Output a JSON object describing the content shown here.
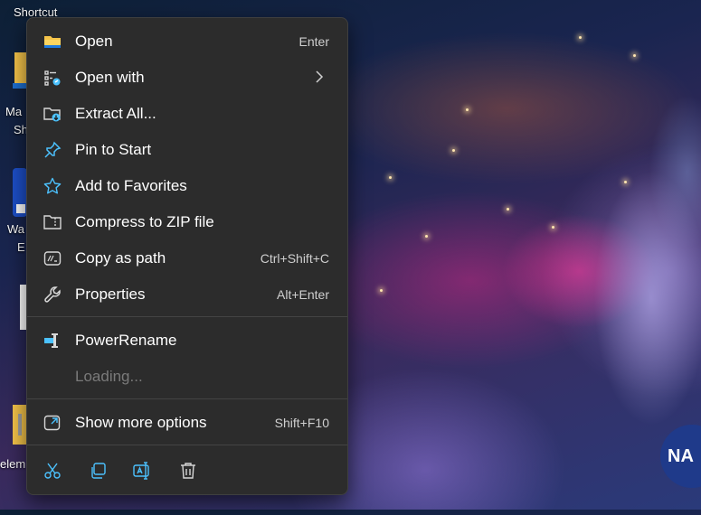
{
  "desktop": {
    "labels": {
      "top": "Shortcut",
      "icon2_a": "Ma",
      "icon2_b": "Sh",
      "icon3_a": "Wa",
      "icon3_b": "E",
      "icon4": "elem"
    },
    "wallpaper_badge": "NA"
  },
  "menu": {
    "items": [
      {
        "label": "Open",
        "accel": "Enter",
        "icon": "folder-icon"
      },
      {
        "label": "Open with",
        "accel": "",
        "icon": "open-with-icon"
      },
      {
        "label": "Extract All...",
        "accel": "",
        "icon": "extract-icon"
      },
      {
        "label": "Pin to Start",
        "accel": "",
        "icon": "pin-icon"
      },
      {
        "label": "Add to Favorites",
        "accel": "",
        "icon": "star-icon"
      },
      {
        "label": "Compress to ZIP file",
        "accel": "",
        "icon": "zip-icon"
      },
      {
        "label": "Copy as path",
        "accel": "Ctrl+Shift+C",
        "icon": "copy-path-icon"
      },
      {
        "label": "Properties",
        "accel": "Alt+Enter",
        "icon": "wrench-icon"
      },
      {
        "label": "PowerRename",
        "accel": "",
        "icon": "powerrename-icon"
      },
      {
        "label": "Loading...",
        "accel": "",
        "icon": ""
      },
      {
        "label": "Show more options",
        "accel": "Shift+F10",
        "icon": "show-more-icon"
      }
    ],
    "toolbar": [
      "cut-icon",
      "copy-icon",
      "rename-icon",
      "delete-icon"
    ],
    "colors": {
      "background": "#2c2c2c",
      "accent": "#4cc2ff",
      "text": "#ffffff",
      "disabled": "#7a7a7a"
    }
  }
}
